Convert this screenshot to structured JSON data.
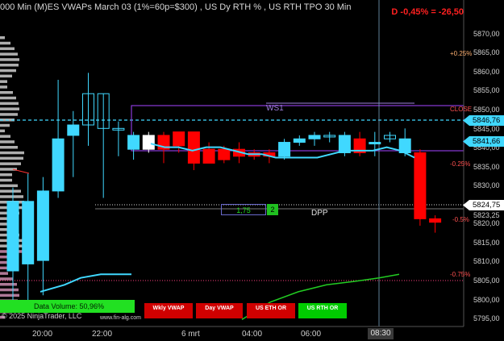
{
  "window": {
    "title": "000 Min (M)ES VWAPs March 03 (1%=60p=$300) , US Dy RTH % , US RTH TPO 30 Min",
    "daily_change": "D -0,45% = -26,50"
  },
  "price_axis": {
    "labels": [
      "5870,00",
      "5865,00",
      "5860,00",
      "5855,00",
      "5850,00",
      "5845,00",
      "5840,00",
      "5835,00",
      "5830,00",
      "5825,00",
      "5820,00",
      "5815,00",
      "5810,00",
      "5805,00",
      "5800,00",
      "5795,00"
    ],
    "partial_label": "5823,25"
  },
  "price_tags": [
    {
      "text": "5846,76",
      "color": "#40d8ff"
    },
    {
      "text": "5841,66",
      "color": "#40d8ff"
    },
    {
      "text": "5824,75",
      "color": "#ffffff"
    }
  ],
  "percent_labels": [
    {
      "text": "+0.25%",
      "color": "#ffb070"
    },
    {
      "text": "CLOSE",
      "color": "#ff5050"
    },
    {
      "text": "-0.25%",
      "color": "#ff5050"
    },
    {
      "text": "-0.5%",
      "color": "#ff5050"
    },
    {
      "text": "-0.75%",
      "color": "#ff5050"
    }
  ],
  "time_axis": [
    "20:00",
    "22:00",
    "6 mrt",
    "04:00",
    "06:00"
  ],
  "time_cursor": "08:30",
  "annotations": {
    "ws1": "WS1",
    "dpp": "DPP",
    "value_box": "1,75",
    "count_box": "2"
  },
  "buttons": {
    "wkly_vwap": "Wkly VWAP",
    "day_vwap": "Day VWAP",
    "us_eth_or": "US ETH OR",
    "us_rth_or": "US RTH OR"
  },
  "volume": "Data Volume: 50,96%",
  "footer": {
    "copyright": "© 2025 NinjaTrader, LLC",
    "site": "www.fin-alg.com"
  },
  "colors": {
    "bull": "#40d8ff",
    "bear": "#ff0000",
    "vwap": "#40d8ff",
    "rth_box": "#8a3ad8",
    "green_line": "#22cc22",
    "profile": "#e8e8e8",
    "profile_pink": "#e8a0c8"
  },
  "chart_data": {
    "type": "candlestick",
    "ylim": [
      5793,
      5880
    ],
    "candles": [
      {
        "o": 5809,
        "h": 5833,
        "l": 5800,
        "c": 5829,
        "dir": "up"
      },
      {
        "o": 5811,
        "h": 5837,
        "l": 5797,
        "c": 5829,
        "dir": "up"
      },
      {
        "o": 5812,
        "h": 5836,
        "l": 5802,
        "c": 5832,
        "dir": "up"
      },
      {
        "o": 5832,
        "h": 5864,
        "l": 5830,
        "c": 5847,
        "dir": "up"
      },
      {
        "o": 5848,
        "h": 5855,
        "l": 5836,
        "c": 5851,
        "dir": "up"
      },
      {
        "o": 5851,
        "h": 5866,
        "l": 5845,
        "c": 5860,
        "dir": "up"
      },
      {
        "o": 5850,
        "h": 5860,
        "l": 5830,
        "c": 5860,
        "dir": "up"
      },
      {
        "o": 5850,
        "h": 5852,
        "l": 5842,
        "c": 5850,
        "dir": "flat"
      },
      {
        "o": 5844,
        "h": 5849,
        "l": 5841,
        "c": 5848,
        "dir": "up"
      },
      {
        "o": 5844,
        "h": 5849,
        "l": 5843,
        "c": 5848,
        "dir": "white"
      },
      {
        "o": 5844,
        "h": 5849,
        "l": 5840,
        "c": 5848,
        "dir": "down"
      },
      {
        "o": 5849,
        "h": 5849,
        "l": 5843,
        "c": 5845,
        "dir": "down"
      },
      {
        "o": 5849,
        "h": 5849,
        "l": 5838,
        "c": 5840,
        "dir": "down"
      },
      {
        "o": 5844,
        "h": 5846,
        "l": 5840,
        "c": 5840,
        "dir": "down"
      },
      {
        "o": 5844,
        "h": 5845,
        "l": 5840,
        "c": 5841,
        "dir": "down"
      },
      {
        "o": 5844,
        "h": 5846,
        "l": 5840,
        "c": 5842,
        "dir": "down"
      },
      {
        "o": 5843,
        "h": 5844,
        "l": 5841,
        "c": 5842,
        "dir": "down"
      },
      {
        "o": 5843,
        "h": 5844,
        "l": 5840,
        "c": 5842,
        "dir": "down"
      },
      {
        "o": 5842,
        "h": 5847,
        "l": 5841,
        "c": 5846,
        "dir": "up"
      },
      {
        "o": 5846,
        "h": 5848,
        "l": 5845,
        "c": 5847,
        "dir": "up"
      },
      {
        "o": 5847,
        "h": 5849,
        "l": 5845,
        "c": 5848,
        "dir": "up"
      },
      {
        "o": 5848,
        "h": 5849,
        "l": 5846,
        "c": 5848,
        "dir": "flat"
      },
      {
        "o": 5848,
        "h": 5849,
        "l": 5842,
        "c": 5843,
        "dir": "up"
      },
      {
        "o": 5847,
        "h": 5849,
        "l": 5842,
        "c": 5843,
        "dir": "down"
      },
      {
        "o": 5846,
        "h": 5849,
        "l": 5842,
        "c": 5846,
        "dir": "up"
      },
      {
        "o": 5848,
        "h": 5849,
        "l": 5846,
        "c": 5847,
        "dir": "flat"
      },
      {
        "o": 5847,
        "h": 5850,
        "l": 5842,
        "c": 5843,
        "dir": "up"
      },
      {
        "o": 5843,
        "h": 5844,
        "l": 5822,
        "c": 5824,
        "dir": "down"
      },
      {
        "o": 5824,
        "h": 5825,
        "l": 5820,
        "c": 5823,
        "dir": "down"
      }
    ],
    "vwap": [
      5847,
      5846,
      5846,
      5845,
      5846,
      5846,
      5845,
      5844,
      5844,
      5843,
      5843,
      5843,
      5843,
      5844,
      5845,
      5845,
      5845,
      5846,
      5845,
      5843
    ],
    "session_vwap": [
      5803,
      5805,
      5807,
      5808,
      5808,
      5808
    ],
    "eth_vwap": [
      5795,
      5800,
      5803,
      5805,
      5806,
      5807,
      5808
    ],
    "levels": {
      "ws1": 5851,
      "dpp": 5824,
      "rth_high": 5851,
      "rth_low": 5840,
      "minus075": 5804
    }
  }
}
